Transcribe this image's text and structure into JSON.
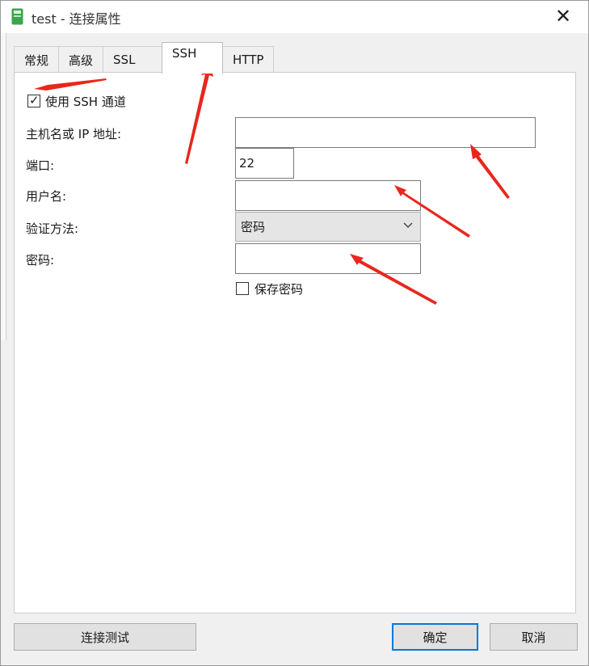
{
  "window": {
    "title": "test - 连接属性",
    "close_symbol": "✕"
  },
  "tabs": [
    {
      "label": "常规"
    },
    {
      "label": "高级"
    },
    {
      "label": "SSL"
    },
    {
      "label": "SSH",
      "active": true
    },
    {
      "label": "HTTP"
    }
  ],
  "ssh": {
    "use_ssh_label": "使用 SSH 通道",
    "use_ssh_checked": true,
    "host_label": "主机名或 IP 地址:",
    "host_value": "",
    "port_label": "端口:",
    "port_value": "22",
    "username_label": "用户名:",
    "username_value": "",
    "auth_label": "验证方法:",
    "auth_value": "密码",
    "password_label": "密码:",
    "password_value": "",
    "save_password_label": "保存密码",
    "save_password_checked": false
  },
  "buttons": {
    "test_connection": "连接测试",
    "ok": "确定",
    "cancel": "取消"
  },
  "colors": {
    "annotation_arrow": "#e8271d",
    "default_button_border": "#0078d7",
    "app_icon": "#3aa54a"
  },
  "icons": [
    "app-icon",
    "close-icon",
    "checkbox-icon",
    "chevron-down-icon"
  ]
}
